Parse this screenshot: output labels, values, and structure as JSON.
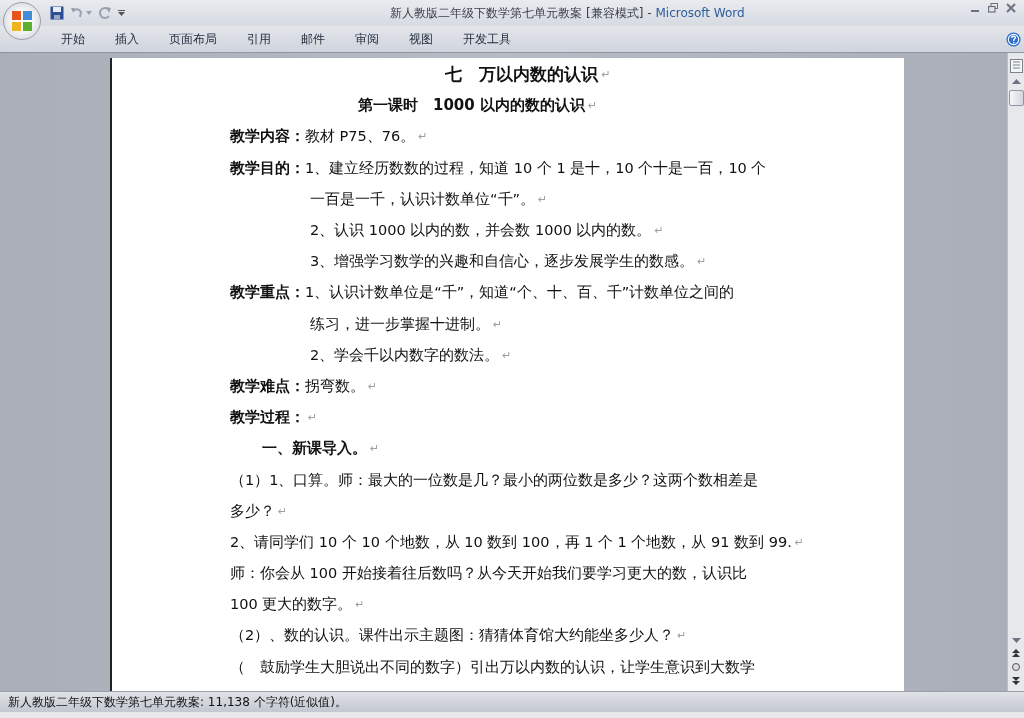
{
  "window": {
    "doc_title": "新人教版二年级下数学第七单元教案 [兼容模式]",
    "separator": "-",
    "app_name": "Microsoft Word"
  },
  "tabs": [
    {
      "label": "开始",
      "selected": false
    },
    {
      "label": "插入",
      "selected": false
    },
    {
      "label": "页面布局",
      "selected": false
    },
    {
      "label": "引用",
      "selected": false
    },
    {
      "label": "邮件",
      "selected": false
    },
    {
      "label": "审阅",
      "selected": false
    },
    {
      "label": "视图",
      "selected": false
    },
    {
      "label": "开发工具",
      "selected": false
    }
  ],
  "document": {
    "lines": [
      {
        "kind": "title",
        "text": "七　万以内数的认识",
        "mark": "↵"
      },
      {
        "kind": "subtitle",
        "text": "第一课时　1000 以内的数的认识",
        "mark": "↵"
      },
      {
        "kind": "field",
        "label": "教学内容：",
        "text": "教材 P75、76。",
        "mark": "↵"
      },
      {
        "kind": "field",
        "label": "教学目的：",
        "text": "1、建立经历数数的过程，知道 10 个 1 是十，10 个十是一百，10 个"
      },
      {
        "kind": "cont",
        "text": "一百是一千，认识计数单位“千”。",
        "mark": "↵"
      },
      {
        "kind": "cont",
        "text": "2、认识 1000 以内的数，并会数 1000 以内的数。",
        "mark": "↵"
      },
      {
        "kind": "cont",
        "text": "3、增强学习数学的兴趣和自信心，逐步发展学生的数感。",
        "mark": "↵"
      },
      {
        "kind": "field",
        "label": "教学重点：",
        "text": "1、认识计数单位是“千”，知道“个、十、百、千”计数单位之间的"
      },
      {
        "kind": "cont",
        "text": "练习，进一步掌握十进制。",
        "mark": "↵"
      },
      {
        "kind": "cont",
        "text": "2、学会千以内数字的数法。",
        "mark": "↵"
      },
      {
        "kind": "field",
        "label": "教学难点：",
        "text": "拐弯数。",
        "mark": "↵"
      },
      {
        "kind": "field",
        "label": "教学过程：",
        "mark": "↵"
      },
      {
        "kind": "heading",
        "text": "一、新课导入。",
        "mark": "↵"
      },
      {
        "kind": "body",
        "text": "（1）1、口算。师：最大的一位数是几？最小的两位数是多少？这两个数相差是"
      },
      {
        "kind": "body",
        "text": "多少？",
        "mark": "↵"
      },
      {
        "kind": "body",
        "text": "2、请同学们 10 个 10 个地数，从 10 数到 100，再 1 个 1 个地数，从 91 数到 99.",
        "mark": "↵"
      },
      {
        "kind": "body",
        "text": "师：你会从 100 开始接着往后数吗？从今天开始我们要学习更大的数，认识比"
      },
      {
        "kind": "body",
        "text": "100 更大的数字。",
        "mark": "↵"
      },
      {
        "kind": "body",
        "text": "（2）、数的认识。课件出示主题图：猜猜体育馆大约能坐多少人？",
        "mark": "↵"
      },
      {
        "kind": "body",
        "text": "（　鼓励学生大胆说出不同的数字）引出万以内数的认识，让学生意识到大数学"
      }
    ]
  },
  "status_bar": {
    "text": "新人教版二年级下数学第七单元教案: 11,138 个字符(近似值)。"
  }
}
